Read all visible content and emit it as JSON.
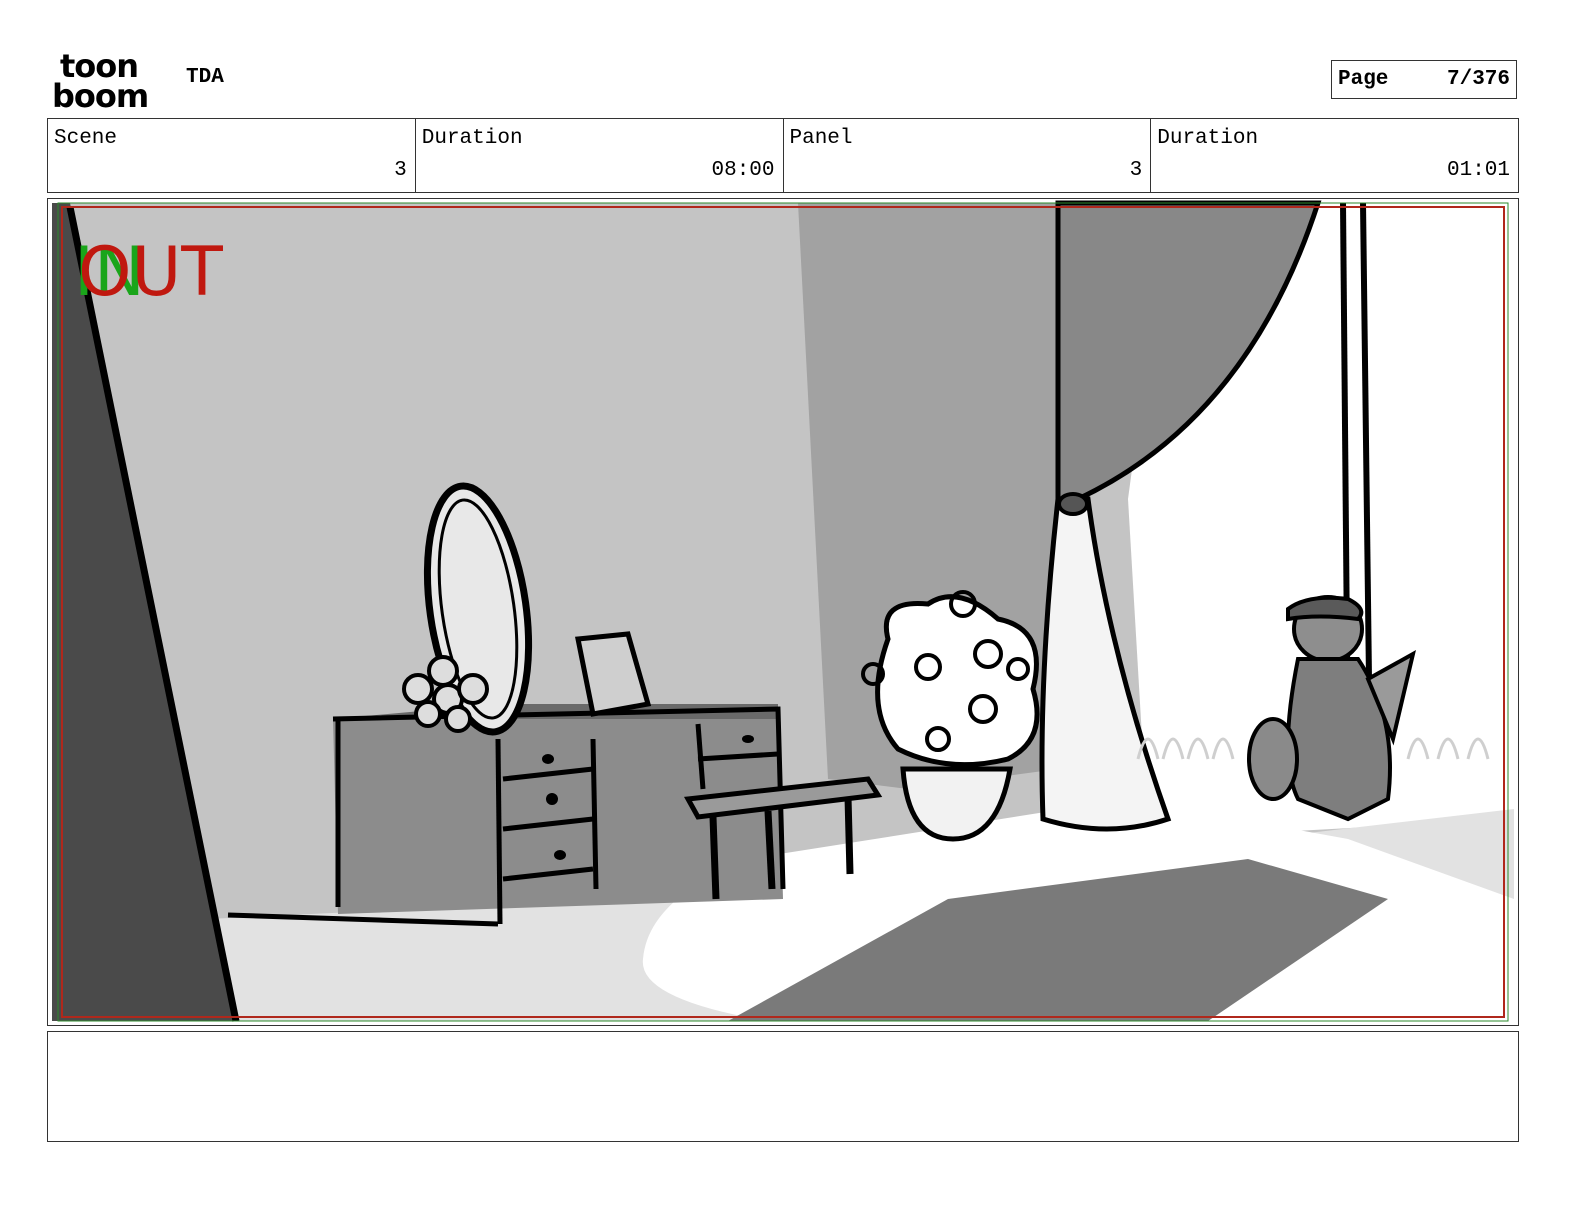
{
  "header": {
    "logo_top": "toon",
    "logo_bottom": "boom",
    "project": "TDA",
    "page_label": "Page",
    "page_value": "7/376"
  },
  "info": {
    "scene_label": "Scene",
    "scene_value": "3",
    "scene_duration_label": "Duration",
    "scene_duration_value": "08:00",
    "panel_label": "Panel",
    "panel_value": "3",
    "panel_duration_label": "Duration",
    "panel_duration_value": "01:01"
  },
  "panel": {
    "in_marker": "IN",
    "out_marker": "OUT",
    "in_color": "#1aa51a",
    "out_color": "#c0180f",
    "frame_color": "#b0281c",
    "safe_frame_color": "#2b8a2b"
  },
  "caption": {
    "text": ""
  }
}
